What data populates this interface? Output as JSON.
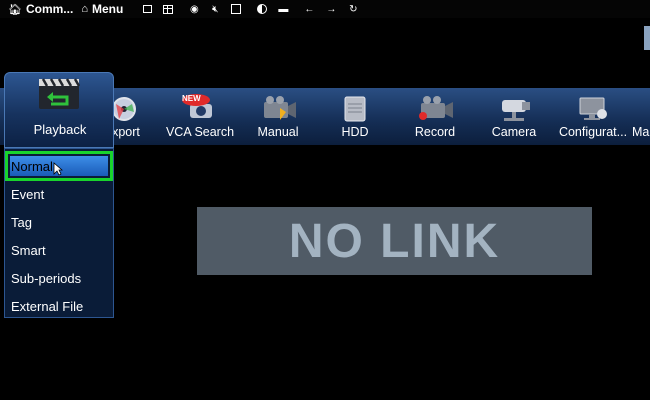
{
  "topbar": {
    "comm_label": "Comm...",
    "menu_label": "Menu"
  },
  "main_menu": [
    {
      "label": "xport",
      "icon": "export-disc-icon"
    },
    {
      "label": "VCA Search",
      "icon": "vca-search-icon",
      "badge": "NEW"
    },
    {
      "label": "Manual",
      "icon": "manual-record-camera-icon"
    },
    {
      "label": "HDD",
      "icon": "hdd-icon"
    },
    {
      "label": "Record",
      "icon": "record-camera-icon"
    },
    {
      "label": "Camera",
      "icon": "cctv-camera-icon"
    },
    {
      "label": "Configurat...",
      "icon": "configuration-monitor-icon"
    },
    {
      "label": "Ma",
      "icon": ""
    }
  ],
  "playback": {
    "label": "Playback",
    "icon": "clapperboard-icon"
  },
  "submenu": {
    "items": [
      "Normal",
      "Event",
      "Tag",
      "Smart",
      "Sub-periods",
      "External File"
    ],
    "selected": "Normal"
  },
  "status": {
    "no_link": "NO LINK"
  },
  "colors": {
    "selection_border": "#19d32d",
    "selection_fill": "#2a74d6",
    "menubar": "#1a3868",
    "no_link_bg": "#505b66",
    "no_link_text": "#a3b3c1"
  }
}
